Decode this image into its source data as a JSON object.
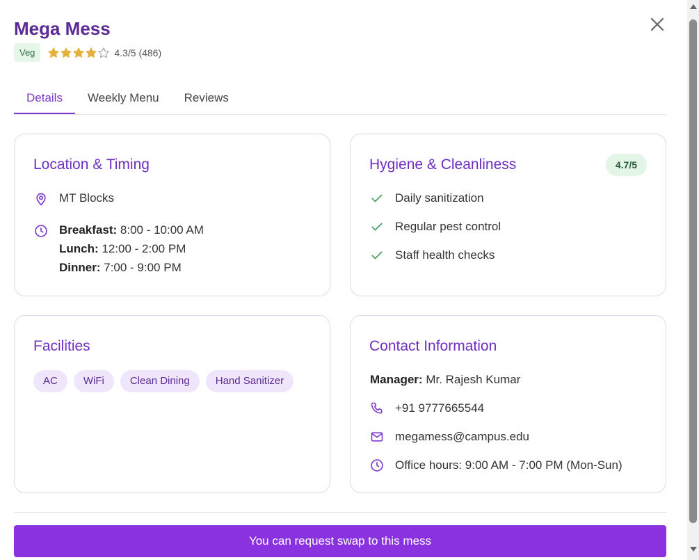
{
  "header": {
    "title": "Mega Mess",
    "diet_badge": "Veg",
    "rating_value": 4.3,
    "rating_max": 5,
    "rating_text": "4.3/5 (486)"
  },
  "tabs": [
    {
      "label": "Details",
      "active": true
    },
    {
      "label": "Weekly Menu",
      "active": false
    },
    {
      "label": "Reviews",
      "active": false
    }
  ],
  "location": {
    "title": "Location & Timing",
    "place": "MT Blocks",
    "meals": [
      {
        "label": "Breakfast:",
        "time": "8:00 - 10:00 AM"
      },
      {
        "label": "Lunch:",
        "time": "12:00 - 2:00 PM"
      },
      {
        "label": "Dinner:",
        "time": "7:00 - 9:00 PM"
      }
    ]
  },
  "hygiene": {
    "title": "Hygiene & Cleanliness",
    "score": "4.7/5",
    "items": [
      "Daily sanitization",
      "Regular pest control",
      "Staff health checks"
    ]
  },
  "facilities": {
    "title": "Facilities",
    "items": [
      "AC",
      "WiFi",
      "Clean Dining",
      "Hand Sanitizer"
    ]
  },
  "contact": {
    "title": "Contact Information",
    "manager_label": "Manager:",
    "manager_name": "Mr. Rajesh Kumar",
    "phone": "+91 9777665544",
    "email": "megamess@campus.edu",
    "office_hours": "Office hours: 9:00 AM - 7:00 PM (Mon-Sun)"
  },
  "cta_label": "You can request swap to this mess",
  "icons": {
    "close": "close-icon",
    "star": "star-icon",
    "location": "map-pin-icon",
    "clock": "clock-icon",
    "check": "check-icon",
    "phone": "phone-icon",
    "mail": "mail-icon"
  },
  "colors": {
    "brand_purple": "#7c3acd",
    "title_purple": "#5b2a94",
    "star_gold": "#e3b23c",
    "check_green": "#3f9b57",
    "cta_bg": "#8a32e0"
  }
}
